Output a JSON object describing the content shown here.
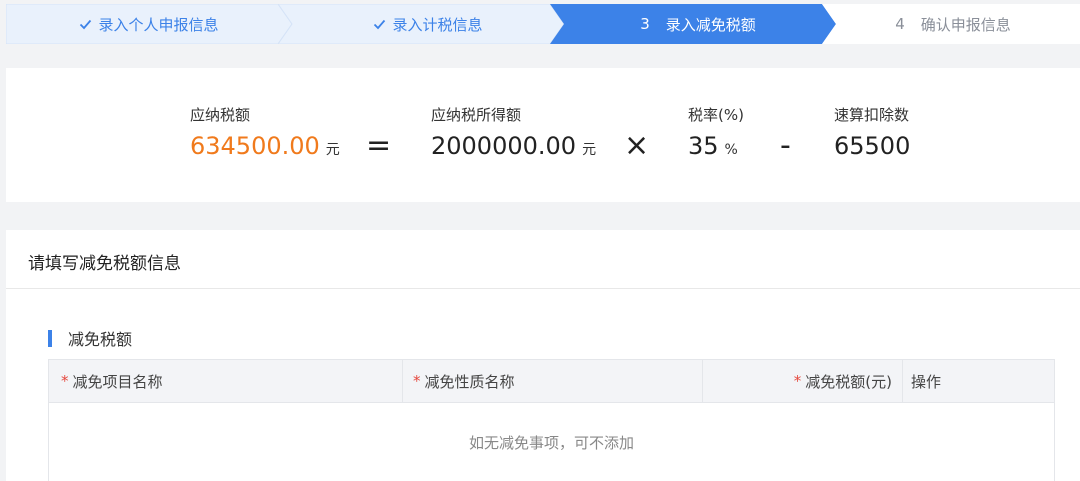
{
  "steps": [
    {
      "label": "录入个人申报信息",
      "status": "done",
      "number": ""
    },
    {
      "label": "录入计税信息",
      "status": "done",
      "number": ""
    },
    {
      "label": "录入减免税额",
      "status": "active",
      "number": "3"
    },
    {
      "label": "确认申报信息",
      "status": "todo",
      "number": "4"
    }
  ],
  "formula": {
    "tax_payable": {
      "label": "应纳税额",
      "value": "634500.00",
      "unit": "元"
    },
    "equals": "=",
    "taxable_income": {
      "label": "应纳税所得额",
      "value": "2000000.00",
      "unit": "元"
    },
    "times": "×",
    "tax_rate": {
      "label": "税率(%)",
      "value": "35",
      "unit": "%"
    },
    "minus": "-",
    "quick_deduction": {
      "label": "速算扣除数",
      "value": "65500"
    }
  },
  "section": {
    "title": "请填写减免税额信息",
    "subtitle": "减免税额",
    "table": {
      "required_mark": "*",
      "columns": [
        "减免项目名称",
        "减免性质名称",
        "减免税额(元)",
        "操作"
      ],
      "empty_text": "如无减免事项，可不添加"
    }
  },
  "colors": {
    "accent": "#3c82e8",
    "orange": "#f07a1c",
    "required": "#e5483e"
  },
  "icons": {
    "done_step": "check-icon"
  }
}
